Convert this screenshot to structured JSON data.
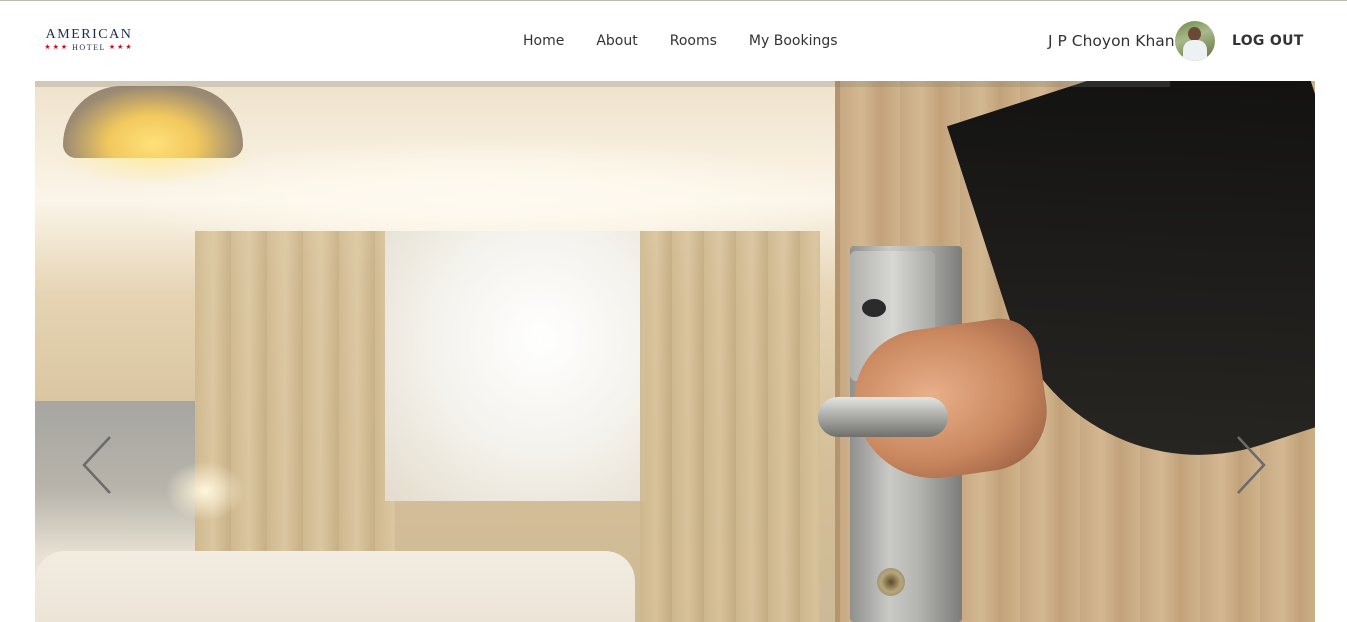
{
  "header": {
    "logo": {
      "main": "AMERICAN",
      "sub": "HOTEL",
      "stars": "★★★"
    },
    "nav": [
      {
        "label": "Home"
      },
      {
        "label": "About"
      },
      {
        "label": "Rooms"
      },
      {
        "label": "My Bookings"
      }
    ],
    "user": {
      "name": "J P Choyon Khan",
      "avatar_icon": "user-avatar"
    },
    "logout_label": "LOG OUT"
  },
  "hero": {
    "image_description": "hotel-door-key-card-lock",
    "prev_icon": "chevron-left-icon",
    "next_icon": "chevron-right-icon"
  },
  "colors": {
    "brand_navy": "#1f2a56",
    "brand_red": "#c8102e",
    "text": "#333333"
  }
}
